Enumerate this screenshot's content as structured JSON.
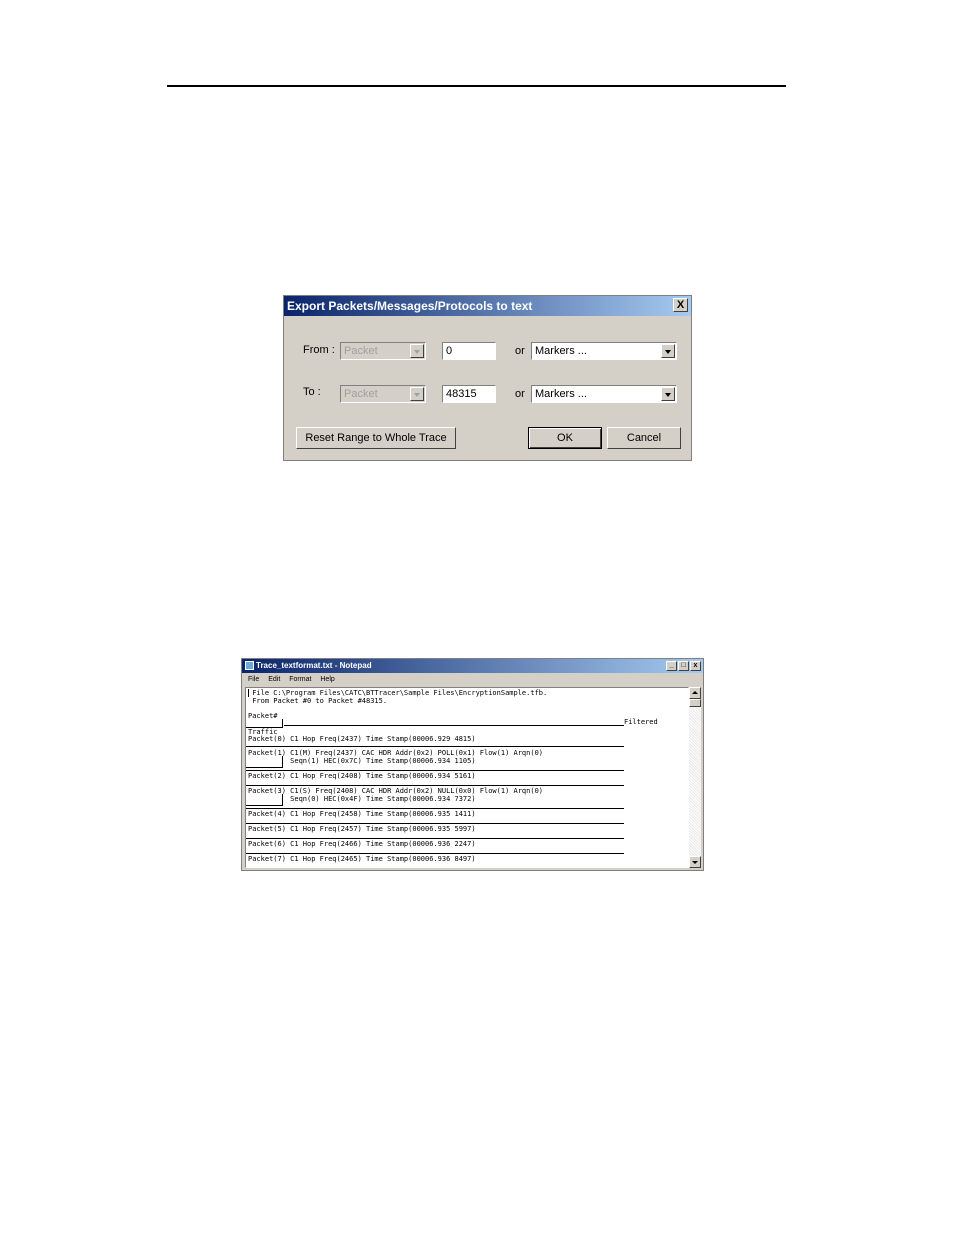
{
  "dialog": {
    "title": "Export Packets/Messages/Protocols to text",
    "close_label": "X",
    "from_label": "From :",
    "to_label": "To :",
    "from_type": "Packet",
    "to_type": "Packet",
    "from_value": "0",
    "to_value": "48315",
    "or_label": "or",
    "from_markers": "Markers ...",
    "to_markers": "Markers ...",
    "reset_button": "Reset Range to Whole Trace",
    "ok_button": "OK",
    "cancel_button": "Cancel"
  },
  "notepad": {
    "title": "Trace_textformat.txt - Notepad",
    "menu": [
      "File",
      "Edit",
      "Format",
      "Help"
    ],
    "window_buttons": {
      "minimize": "_",
      "maximize": "□",
      "close": "x"
    },
    "lines": [
      " File C:\\Program Files\\CATC\\BTTracer\\Sample Files\\EncryptionSample.tfb.",
      " From Packet #0 to Packet #48315.",
      "Packet#",
      "Traffic",
      "Filtered",
      "Packet(0) C1 Hop Freq(2437) Time Stamp(00006.929 4815)",
      "Packet(1) C1(M) Freq(2437) CAC HDR Addr(0x2) POLL(0x1) Flow(1) Arqn(0)",
      "          Seqn(1) HEC(0x7C) Time Stamp(00006.934 1105)",
      "Packet(2) C1 Hop Freq(2408) Time Stamp(00006.934 5161)",
      "Packet(3) C1(S) Freq(2408) CAC HDR Addr(0x2) NULL(0x0) Flow(1) Arqn(0)",
      "          Seqn(0) HEC(0x4F) Time Stamp(00006.934 7372)",
      "Packet(4) C1 Hop Freq(2458) Time Stamp(00006.935 1411)",
      "Packet(5) C1 Hop Freq(2457) Time Stamp(00006.935 5997)",
      "Packet(6) C1 Hop Freq(2466) Time Stamp(00006.936 2247)",
      "Packet(7) C1 Hop Freq(2465) Time Stamp(00006.936 8497)"
    ]
  }
}
